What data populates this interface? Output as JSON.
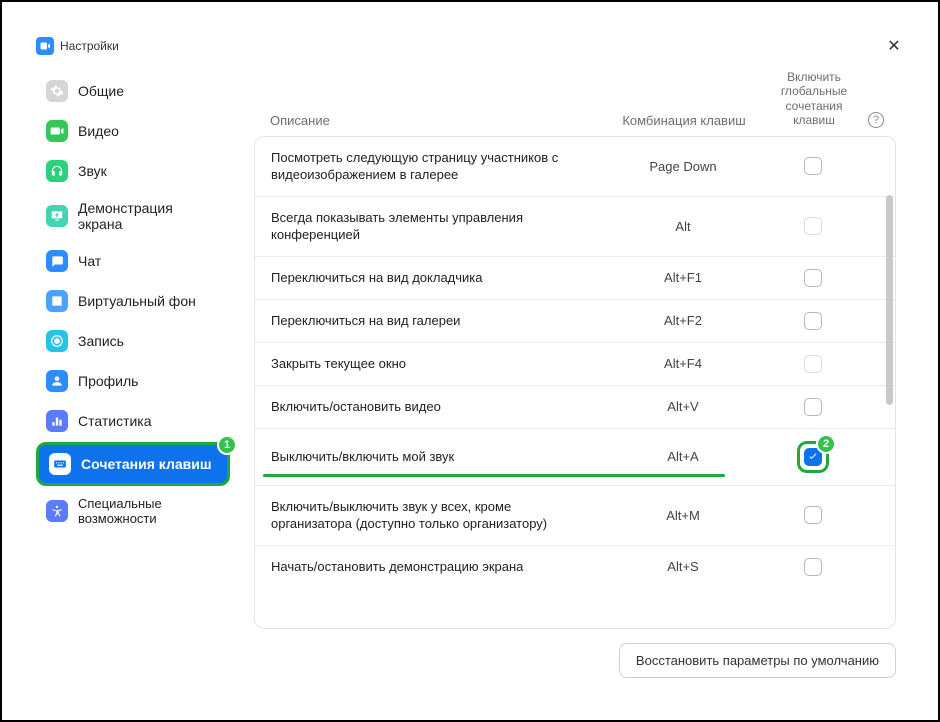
{
  "window": {
    "title": "Настройки"
  },
  "sidebar": {
    "items": [
      {
        "label": "Общие"
      },
      {
        "label": "Видео"
      },
      {
        "label": "Звук"
      },
      {
        "label": "Демонстрация экрана"
      },
      {
        "label": "Чат"
      },
      {
        "label": "Виртуальный фон"
      },
      {
        "label": "Запись"
      },
      {
        "label": "Профиль"
      },
      {
        "label": "Статистика"
      },
      {
        "label": "Сочетания клавиш"
      },
      {
        "label": "Специальные",
        "label2": "возможности"
      }
    ]
  },
  "headers": {
    "description": "Описание",
    "shortcut": "Комбинация клавиш",
    "global": "Включить глобальные сочетания клавиш"
  },
  "rows": [
    {
      "desc": "Посмотреть следующую страницу участников с видеоизображением в галерее",
      "combo": "Page Down"
    },
    {
      "desc": "Всегда показывать элементы управления конференцией",
      "combo": "Alt"
    },
    {
      "desc": "Переключиться на вид докладчика",
      "combo": "Alt+F1"
    },
    {
      "desc": "Переключиться на вид галереи",
      "combo": "Alt+F2"
    },
    {
      "desc": "Закрыть текущее окно",
      "combo": "Alt+F4"
    },
    {
      "desc": "Включить/остановить видео",
      "combo": "Alt+V"
    },
    {
      "desc": "Выключить/включить мой звук",
      "combo": "Alt+A"
    },
    {
      "desc": "Включить/выключить звук у всех, кроме организатора (доступно только организатору)",
      "combo": "Alt+M"
    },
    {
      "desc": "Начать/остановить демонстрацию экрана",
      "combo": "Alt+S"
    }
  ],
  "footer": {
    "restore": "Восстановить параметры по умолчанию"
  },
  "badges": {
    "one": "1",
    "two": "2"
  },
  "help": "?"
}
